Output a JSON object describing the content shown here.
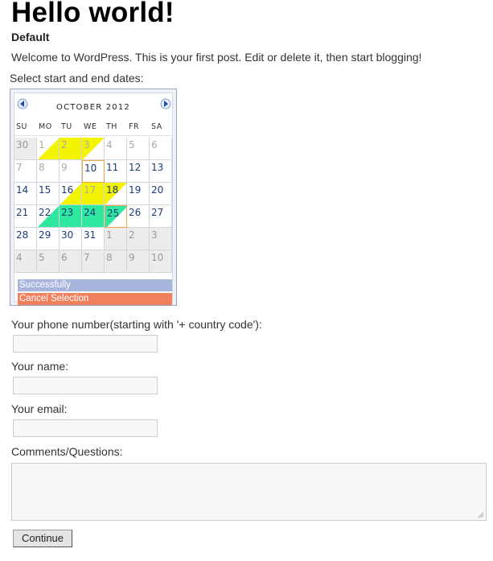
{
  "post": {
    "title": "Hello world!",
    "category": "Default",
    "intro": "Welcome to WordPress. This is your first post. Edit or delete it, then start blogging!"
  },
  "calendar": {
    "label": "Select start and end dates:",
    "month": "OCTOBER 2012",
    "weekdays": [
      "SU",
      "MO",
      "TU",
      "WE",
      "TH",
      "FR",
      "SA"
    ],
    "weeks": [
      [
        "30",
        "1",
        "2",
        "3",
        "4",
        "5",
        "6"
      ],
      [
        "7",
        "8",
        "9",
        "10",
        "11",
        "12",
        "13"
      ],
      [
        "14",
        "15",
        "16",
        "17",
        "18",
        "19",
        "20"
      ],
      [
        "21",
        "22",
        "23",
        "24",
        "25",
        "26",
        "27"
      ],
      [
        "28",
        "29",
        "30",
        "31",
        "1",
        "2",
        "3"
      ],
      [
        "4",
        "5",
        "6",
        "7",
        "8",
        "9",
        "10"
      ]
    ],
    "success_label": "Successfully",
    "cancel_label": "Cancel Selection",
    "colors": {
      "yellow": "#f4f400",
      "green": "#2ee8a0",
      "orange": "#f2a24a",
      "success": "#a8b6de",
      "cancel": "#f1815e"
    }
  },
  "form": {
    "phone_label": "Your phone number(starting with '+ country code'):",
    "phone_value": "",
    "name_label": "Your name:",
    "name_value": "",
    "email_label": "Your email:",
    "email_value": "",
    "comments_label": "Comments/Questions:",
    "comments_value": "",
    "submit_label": "Continue"
  }
}
